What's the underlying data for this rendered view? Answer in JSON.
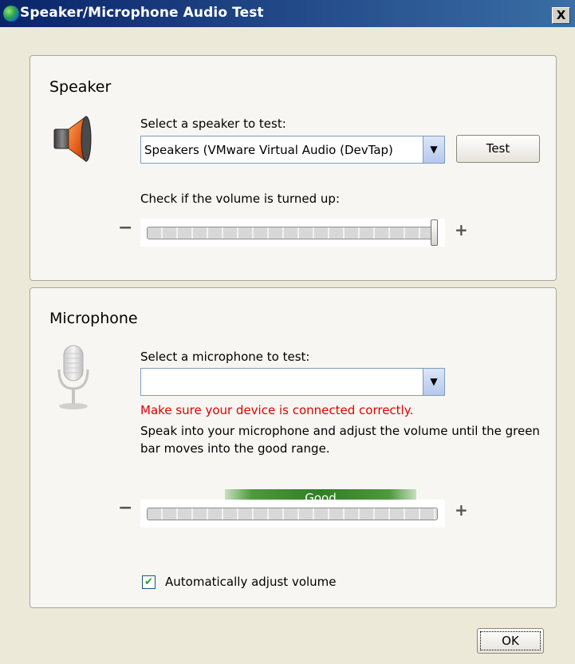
{
  "window": {
    "title": "Speaker/Microphone Audio Test",
    "close_label": "X"
  },
  "speaker": {
    "heading": "Speaker",
    "select_label": "Select a speaker to test:",
    "device_value": "Speakers (VMware Virtual Audio (DevTap)",
    "test_label": "Test",
    "volume_label": "Check if the volume is turned up:",
    "minus": "−",
    "plus": "+",
    "volume_fraction": 1.0
  },
  "microphone": {
    "heading": "Microphone",
    "select_label": "Select a microphone to test:",
    "device_value": "",
    "warning": "Make sure your device is connected correctly.",
    "instructions": "Speak into your microphone and adjust the volume until the green bar moves into the good range.",
    "good_label": "Good",
    "minus": "−",
    "plus": "+",
    "auto_adjust_label": "Automatically adjust volume",
    "auto_adjust_checked": true
  },
  "footer": {
    "ok_label": "OK"
  },
  "icons": {
    "speaker": "speaker-icon",
    "microphone": "microphone-icon",
    "globe": "globe-icon",
    "dropdown": "chevron-down-icon"
  },
  "colors": {
    "warning": "#e00000",
    "good": "#2f7f24",
    "title_bar": "#0a246a"
  }
}
